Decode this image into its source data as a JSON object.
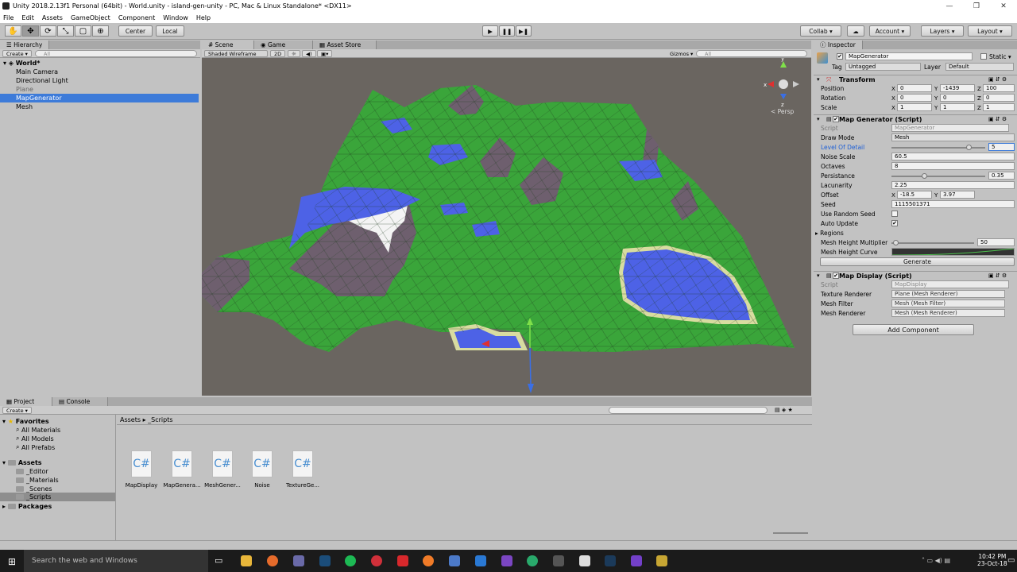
{
  "window": {
    "title": "Unity 2018.2.13f1 Personal (64bit) - World.unity - island-gen-unity - PC, Mac & Linux Standalone* <DX11>",
    "minimize": "—",
    "maximize": "❐",
    "close": "✕"
  },
  "menu": [
    "File",
    "Edit",
    "Assets",
    "GameObject",
    "Component",
    "Window",
    "Help"
  ],
  "toolbar": {
    "pivot": "Center",
    "space": "Local",
    "collab": "Collab ▾",
    "account": "Account",
    "layers": "Layers",
    "layout": "Layout"
  },
  "hierarchy": {
    "tab": "Hierarchy",
    "create": "Create ▾",
    "search_placeholder": "All",
    "scene": "World*",
    "items": [
      "Main Camera",
      "Directional Light",
      "Plane",
      "MapGenerator",
      "Mesh"
    ],
    "selected_index": 3
  },
  "scene": {
    "tabs": [
      "Scene",
      "Game",
      "Asset Store"
    ],
    "shading": "Shaded Wireframe",
    "mode2d": "2D",
    "gizmos": "Gizmos ▾",
    "search_placeholder": "All",
    "persp": "< Persp"
  },
  "inspector": {
    "tab": "Inspector",
    "object_name": "MapGenerator",
    "static_label": "Static ▾",
    "tag_label": "Tag",
    "tag_value": "Untagged",
    "layer_label": "Layer",
    "layer_value": "Default",
    "transform": {
      "title": "Transform",
      "position": {
        "label": "Position",
        "x": "0",
        "y": "-1439",
        "z": "100"
      },
      "rotation": {
        "label": "Rotation",
        "x": "0",
        "y": "0",
        "z": "0"
      },
      "scale": {
        "label": "Scale",
        "x": "1",
        "y": "1",
        "z": "1"
      }
    },
    "map_generator": {
      "title": "Map Generator (Script)",
      "script_label": "Script",
      "script_value": "MapGenerator",
      "draw_mode_label": "Draw Mode",
      "draw_mode_value": "Mesh",
      "lod_label": "Level Of Detail",
      "lod_value": "5",
      "lod_fraction": 0.83,
      "noise_scale_label": "Noise Scale",
      "noise_scale_value": "60.5",
      "octaves_label": "Octaves",
      "octaves_value": "8",
      "persistance_label": "Persistance",
      "persistance_value": "0.35",
      "persistance_fraction": 0.35,
      "lacunarity_label": "Lacunarity",
      "lacunarity_value": "2.25",
      "offset_label": "Offset",
      "offset_x": "-18.5",
      "offset_y": "3.97",
      "seed_label": "Seed",
      "seed_value": "1115501371",
      "use_random_seed_label": "Use Random Seed",
      "use_random_seed": false,
      "auto_update_label": "Auto Update",
      "auto_update": true,
      "regions_label": "Regions",
      "mesh_height_mult_label": "Mesh Height Multiplier",
      "mesh_height_mult_value": "50",
      "mesh_height_mult_fraction": 0.05,
      "mesh_height_curve_label": "Mesh Height Curve",
      "generate": "Generate"
    },
    "map_display": {
      "title": "Map Display (Script)",
      "script_label": "Script",
      "script_value": "MapDisplay",
      "texture_renderer_label": "Texture Renderer",
      "texture_renderer_value": "Plane (Mesh Renderer)",
      "mesh_filter_label": "Mesh Filter",
      "mesh_filter_value": "Mesh (Mesh Filter)",
      "mesh_renderer_label": "Mesh Renderer",
      "mesh_renderer_value": "Mesh (Mesh Renderer)"
    },
    "add_component": "Add Component"
  },
  "project": {
    "tabs": [
      "Project",
      "Console"
    ],
    "create": "Create ▾",
    "favorites_label": "Favorites",
    "favorites": [
      "All Materials",
      "All Models",
      "All Prefabs"
    ],
    "assets_label": "Assets",
    "asset_folders": [
      "_Editor",
      "_Materials",
      "_Scenes",
      "_Scripts"
    ],
    "selected_folder_index": 3,
    "packages_label": "Packages",
    "breadcrumb_root": "Assets",
    "breadcrumb_sep": "▸",
    "breadcrumb_current": "_Scripts",
    "files": [
      "MapDisplay",
      "MapGenera...",
      "MeshGener...",
      "Noise",
      "TextureGe..."
    ]
  },
  "taskbar": {
    "search": "Search the web and Windows",
    "time": "10:42 PM",
    "date": "23-Oct-18"
  },
  "colors": {
    "selection": "#3d7bd9",
    "grass": "#3aa53a",
    "water": "#4d62e6",
    "sand": "#d8dca0",
    "rock": "#6e5f6e",
    "snow": "#f4f4f4"
  }
}
